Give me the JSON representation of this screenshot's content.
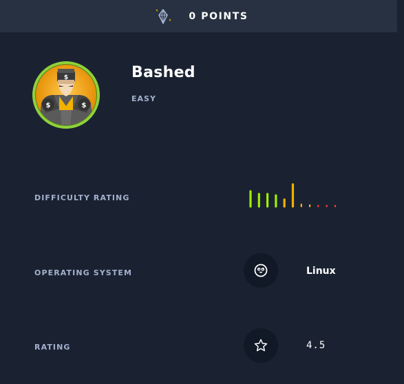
{
  "header": {
    "points_label": "0 POINTS",
    "points_icon": "crystal-diamond-icon"
  },
  "machine": {
    "name": "Bashed",
    "difficulty": "EASY",
    "avatar_icon": "ninja-avatar-icon"
  },
  "stats": {
    "difficulty_label": "DIFFICULTY RATING",
    "difficulty_votes": [
      0.55,
      0.45,
      0.45,
      0.4,
      0.25,
      0.8,
      0.08,
      0.05,
      0.03,
      0.03,
      0.03
    ],
    "difficulty_colors": [
      "#9fef00",
      "#9fef00",
      "#9fef00",
      "#9fef00",
      "#ffaf00",
      "#ffaf00",
      "#ffaf00",
      "#ffaf00",
      "#ff3e3e",
      "#ff3e3e",
      "#ff3e3e"
    ],
    "os_label": "OPERATING SYSTEM",
    "os_value": "Linux",
    "os_icon": "linux-penguin-icon",
    "rating_label": "RATING",
    "rating_value": "4.5",
    "rating_icon": "star-icon"
  },
  "colors": {
    "background": "#1a2232",
    "header_bg": "#273142",
    "label": "#a4b1cd",
    "accent_green": "#9fef00",
    "accent_orange": "#ffaf00",
    "accent_red": "#ff3e3e"
  }
}
